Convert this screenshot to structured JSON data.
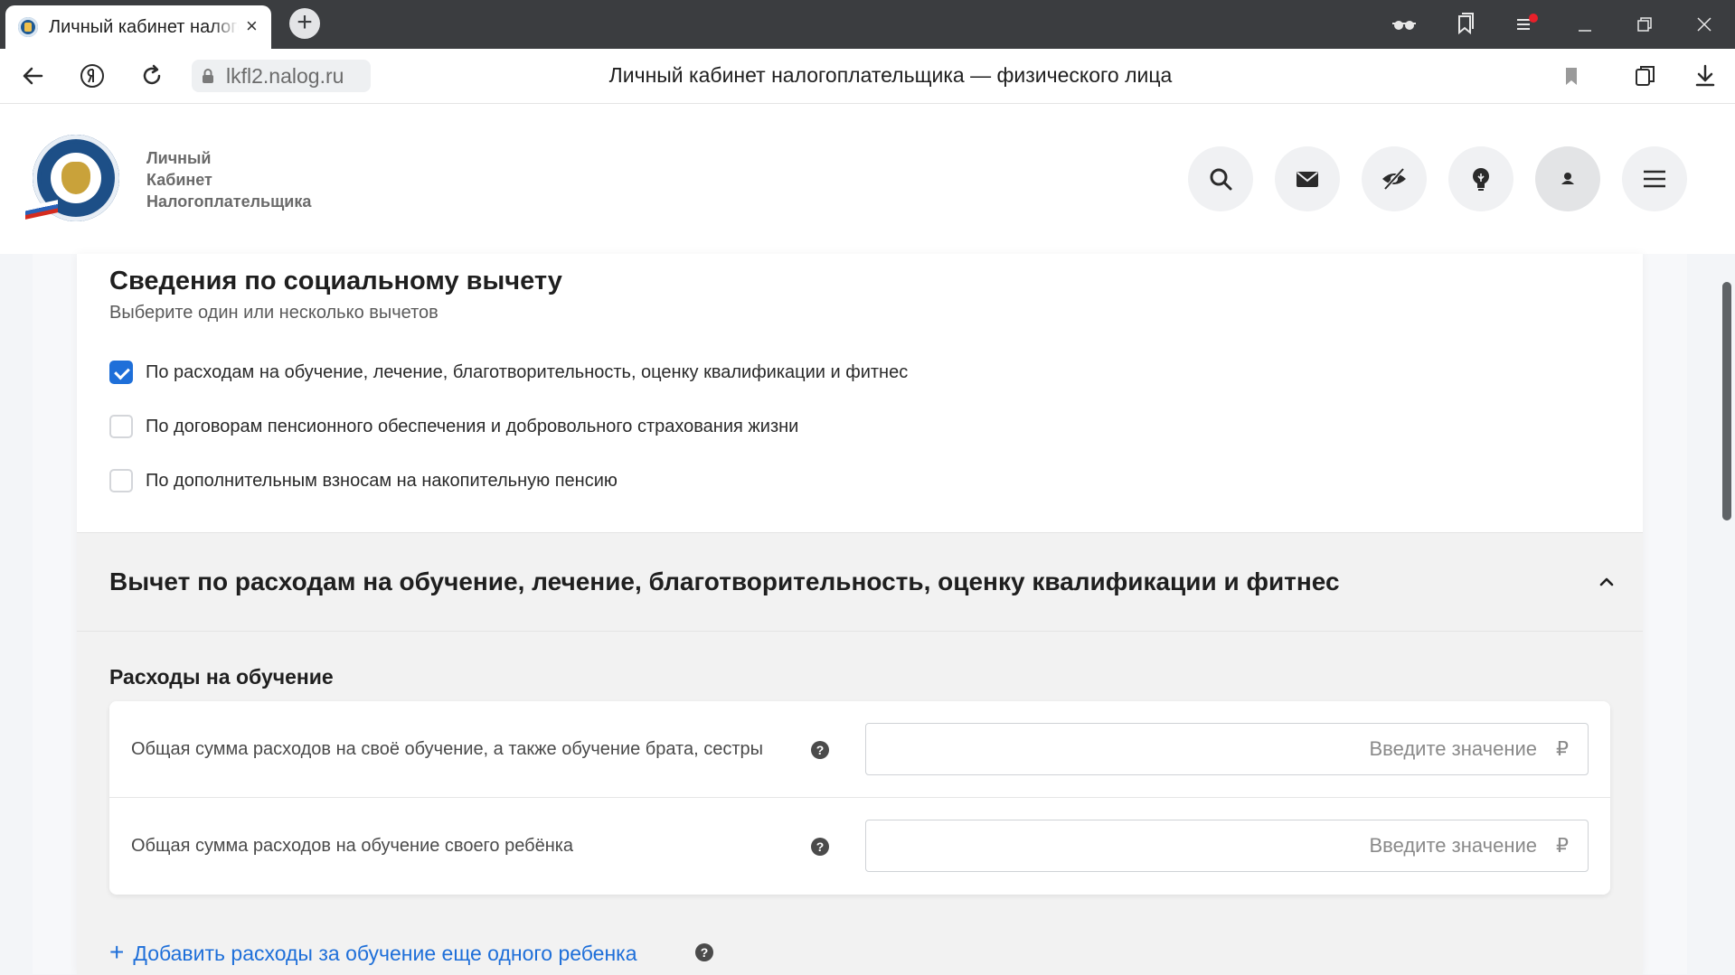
{
  "browser": {
    "tab_title": "Личный кабинет налогоплательщика",
    "tab_close": "×",
    "new_tab": "+",
    "url": "lkfl2.nalog.ru",
    "page_title": "Личный кабинет налогоплательщика — физического лица"
  },
  "header": {
    "brand_line1": "Личный",
    "brand_line2": "Кабинет",
    "brand_line3": "Налогоплательщика"
  },
  "section": {
    "title": "Сведения по социальному вычету",
    "subtitle": "Выберите один или несколько вычетов",
    "options": [
      {
        "label": "По расходам на обучение, лечение, благотворительность, оценку квалификации и фитнес",
        "checked": true
      },
      {
        "label": "По договорам пенсионного обеспечения и добровольного страхования жизни",
        "checked": false
      },
      {
        "label": "По дополнительным взносам на накопительную пенсию",
        "checked": false
      }
    ]
  },
  "accordion": {
    "title": "Вычет по расходам на обучение, лечение, благотворительность, оценку квалификации и фитнес",
    "expanded": true,
    "education": {
      "title": "Расходы на обучение",
      "fields": [
        {
          "label": "Общая сумма расходов на своё обучение, а также обучение брата, сестры",
          "placeholder": "Введите значение",
          "currency": "₽"
        },
        {
          "label": "Общая сумма расходов на обучение своего ребёнка",
          "placeholder": "Введите значение",
          "currency": "₽"
        }
      ],
      "help": "?",
      "add_link_plus": "+",
      "add_link": "Добавить расходы за обучение еще одного ребенка"
    }
  },
  "colors": {
    "accent": "#1e6fd9",
    "chrome_dark": "#3b3d40",
    "notification": "#e8202a"
  },
  "icons": [
    "back-icon",
    "yandex-icon",
    "reload-icon",
    "lock-icon",
    "bookmark-icon",
    "collections-icon",
    "download-icon",
    "reader-glasses-icon",
    "bookmarks-panel-icon",
    "menu-icon",
    "minimize-icon",
    "restore-icon",
    "close-icon",
    "search-icon",
    "mail-icon",
    "eye-off-icon",
    "lightbulb-icon",
    "user-icon",
    "hamburger-icon"
  ]
}
